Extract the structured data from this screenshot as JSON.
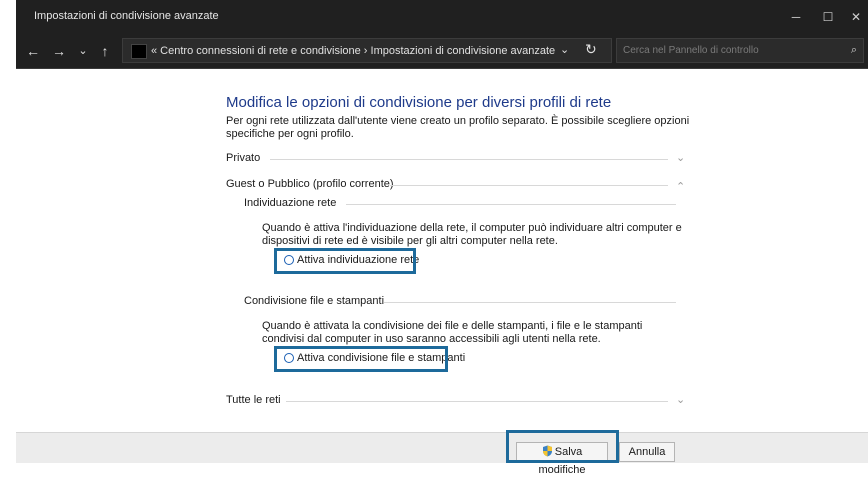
{
  "window": {
    "title": "Impostazioni di condivisione avanzate",
    "minimize": "─",
    "maximize": "☐",
    "close": "✕"
  },
  "nav": {
    "back": "←",
    "forward": "→",
    "recent": "⌄",
    "up": "↑",
    "crumbs": "«  Centro connessioni di rete e condivisione  ›  Impostazioni di condivisione avanzate",
    "dropdown": "⌄",
    "refresh": "↻",
    "search_placeholder": "Cerca nel Pannello di controllo",
    "search_icon": "⌕"
  },
  "main": {
    "heading": "Modifica le opzioni di condivisione per diversi profili di rete",
    "description": "Per ogni rete utilizzata dall'utente viene creato un profilo separato. È possibile scegliere opzioni specifiche per ogni profilo.",
    "sections": {
      "private": {
        "label": "Privato",
        "chevron": "⌄"
      },
      "guest": {
        "label": "Guest o Pubblico (profilo corrente)",
        "chevron": "⌃"
      },
      "all": {
        "label": "Tutte le reti",
        "chevron": "⌄"
      }
    },
    "discovery": {
      "label": "Individuazione rete",
      "text": "Quando è attiva l'individuazione della rete, il computer può individuare altri computer e dispositivi di rete ed è visibile per gli altri computer nella rete.",
      "option": "Attiva individuazione rete"
    },
    "sharing": {
      "label": "Condivisione file e stampanti",
      "text": "Quando è attivata la condivisione dei file e delle stampanti, i file e le stampanti condivisi dal computer in uso saranno accessibili agli utenti nella rete.",
      "option": "Attiva condivisione file e stampanti"
    }
  },
  "footer": {
    "save": "Salva modifiche",
    "cancel": "Annulla"
  },
  "colors": {
    "heading": "#1e3a8a",
    "highlight": "#1d6a9b",
    "titlebar": "#202020"
  },
  "icons": [
    "arrow-left-icon",
    "arrow-right-icon",
    "chevron-down-icon",
    "arrow-up-icon",
    "refresh-icon",
    "search-icon",
    "shield-icon"
  ]
}
